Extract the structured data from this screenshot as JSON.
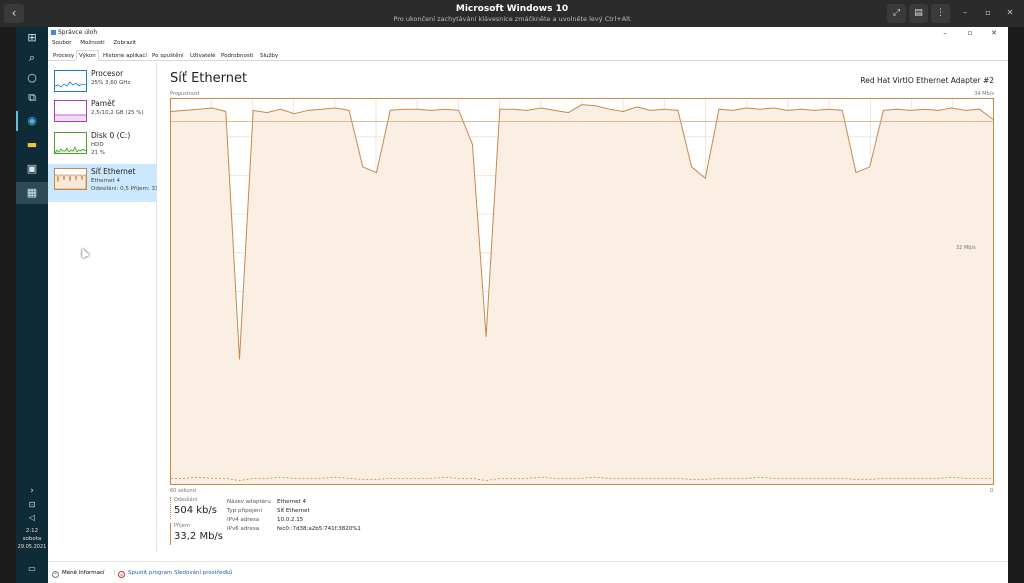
{
  "host": {
    "title": "Microsoft Windows 10",
    "subtitle": "Pro ukončení zachytávání klávesnice zmáčkněte a uvolněte levý Ctrl+Alt"
  },
  "taskbar": {
    "time": "2:12",
    "day": "sobota",
    "date": "29.05.2021"
  },
  "window": {
    "title": "Správce úloh",
    "menu": [
      "Soubor",
      "Možnosti",
      "Zobrazit"
    ],
    "tabs": [
      "Procesy",
      "Výkon",
      "Historie aplikací",
      "Po spuštění",
      "Uživatelé",
      "Podrobnosti",
      "Služby"
    ],
    "selected_tab": "Výkon"
  },
  "resources": [
    {
      "name": "Procesor",
      "sub1": "25% 3,60 GHz",
      "sub2": "",
      "color": "#1a7cc4"
    },
    {
      "name": "Paměť",
      "sub1": "2,5/10,2 GB (25 %)",
      "sub2": "",
      "color": "#a83bbd"
    },
    {
      "name": "Disk 0 (C:)",
      "sub1": "HDD",
      "sub2": "21 %",
      "color": "#4a9e2a"
    },
    {
      "name": "Síť Ethernet",
      "sub1": "Ethernet 4",
      "sub2": "Odesílání: 0,5 Příjem: 33",
      "color": "#c7894b"
    }
  ],
  "main": {
    "title": "Síť Ethernet",
    "adapter": "Red Hat VirtIO Ethernet Adapter #2",
    "throughput_label": "Propustnost",
    "max_label": "34 Mb/s",
    "mid_label": "32 Mb/s",
    "x_left": "60 sekund",
    "x_right": "0"
  },
  "stats": {
    "send_label": "Odesílání",
    "send_value": "504 kb/s",
    "recv_label": "Příjem",
    "recv_value": "33,2 Mb/s",
    "details": [
      {
        "k": "Název adaptéru",
        "v": "Ethernet 4"
      },
      {
        "k": "Typ připojení",
        "v": "Síť Ethernet"
      },
      {
        "k": "IPv4 adresa",
        "v": "10.0.2.15"
      },
      {
        "k": "IPv6 adresa",
        "v": "fec0::7d38:a2b5:741f:3820%1"
      }
    ]
  },
  "footer": {
    "less": "Méně informací",
    "monitor": "Spustit program Sledování prostředků"
  },
  "chart_data": {
    "type": "area",
    "x_range": [
      60,
      0
    ],
    "ylim": [
      0,
      34
    ],
    "y_unit": "Mb/s",
    "series": [
      {
        "values": [
          32.9,
          33.0,
          33.1,
          33.2,
          32.9,
          11.0,
          33.0,
          32.8,
          33.1,
          32.7,
          33.0,
          33.1,
          33.2,
          33.0,
          28.0,
          27.5,
          33.0,
          33.1,
          33.1,
          33.0,
          33.1,
          33.0,
          30.0,
          13.0,
          33.1,
          33.1,
          33.0,
          33.2,
          33.0,
          32.8,
          33.5,
          33.4,
          33.1,
          32.9,
          33.3,
          33.0,
          33.1,
          33.0,
          28.0,
          27.0,
          33.1,
          33.0,
          33.2,
          33.1,
          33.2,
          33.0,
          33.1,
          33.0,
          33.1,
          33.0,
          27.5,
          28.0,
          33.0,
          33.1,
          33.0,
          33.1,
          33.0,
          33.2,
          33.0,
          33.1,
          32.2
        ],
        "color": "#c7894b"
      },
      {
        "values": [
          0.5,
          0.5,
          0.6,
          0.5,
          0.5,
          0.3,
          0.5,
          0.5,
          0.6,
          0.5,
          0.5,
          0.5,
          0.6,
          0.5,
          0.4,
          0.4,
          0.5,
          0.5,
          0.5,
          0.5,
          0.6,
          0.5,
          0.5,
          0.3,
          0.5,
          0.5,
          0.5,
          0.6,
          0.5,
          0.5,
          0.5,
          0.6,
          0.5,
          0.5,
          0.5,
          0.5,
          0.5,
          0.5,
          0.4,
          0.4,
          0.5,
          0.5,
          0.5,
          0.6,
          0.5,
          0.5,
          0.5,
          0.5,
          0.5,
          0.5,
          0.4,
          0.4,
          0.5,
          0.5,
          0.5,
          0.5,
          0.5,
          0.6,
          0.5,
          0.5,
          0.5
        ],
        "color": "#c7894b"
      }
    ]
  }
}
